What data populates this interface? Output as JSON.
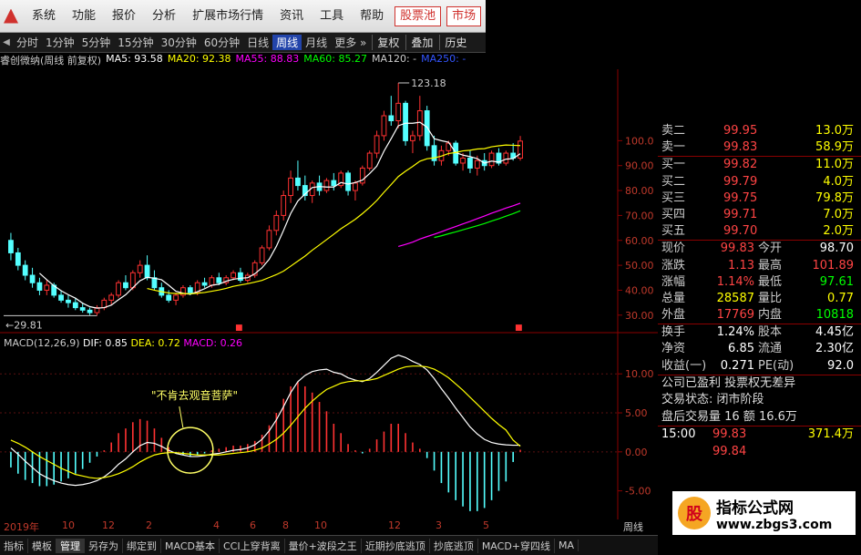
{
  "menu": [
    "系统",
    "功能",
    "报价",
    "分析",
    "扩展市场行情",
    "资讯",
    "工具",
    "帮助"
  ],
  "menu_red": [
    "股票池",
    "市场"
  ],
  "periods": [
    "分时",
    "1分钟",
    "5分钟",
    "15分钟",
    "30分钟",
    "60分钟",
    "日线",
    "周线",
    "月线",
    "更多"
  ],
  "period_active": "周线",
  "period_buttons": [
    "复权",
    "叠加",
    "历史"
  ],
  "stock_title": "睿创微纳(周线 前复权)",
  "ma": [
    {
      "label": "MA5: 93.58",
      "color": "#ffffff"
    },
    {
      "label": "MA20: 92.38",
      "color": "#ffff00"
    },
    {
      "label": "MA55: 88.83",
      "color": "#ff00ff"
    },
    {
      "label": "MA60: 85.27",
      "color": "#00ff00"
    },
    {
      "label": "MA120: -",
      "color": "#cccccc"
    },
    {
      "label": "MA250: -",
      "color": "#3355ff"
    }
  ],
  "price_axis": [
    "100.0",
    "90.00",
    "80.00",
    "70.00",
    "60.00",
    "50.00",
    "40.00",
    "30.00"
  ],
  "macd_axis": [
    "10.00",
    "5.00",
    "0.00",
    "-5.00"
  ],
  "high_label": "123.18",
  "low_label": "29.81",
  "macd_title": "MACD(12,26,9)",
  "macd_dif": "DIF: 0.85",
  "macd_dea": "DEA: 0.72",
  "macd_macd": "MACD: 0.26",
  "annotation": "\"不肯去观音菩萨\"",
  "x_labels": [
    "2019年",
    "10",
    "12",
    "2",
    "4",
    "6",
    "8",
    "10",
    "12",
    "3",
    "5",
    "周线"
  ],
  "quote": {
    "asks": [
      {
        "label": "卖二",
        "price": "99.95",
        "vol": "13.0万"
      },
      {
        "label": "卖一",
        "price": "99.83",
        "vol": "58.9万"
      }
    ],
    "bids": [
      {
        "label": "买一",
        "price": "99.82",
        "vol": "11.0万"
      },
      {
        "label": "买二",
        "price": "99.79",
        "vol": "4.0万"
      },
      {
        "label": "买三",
        "price": "99.75",
        "vol": "79.8万"
      },
      {
        "label": "买四",
        "price": "99.71",
        "vol": "7.0万"
      },
      {
        "label": "买五",
        "price": "99.70",
        "vol": "2.0万"
      }
    ],
    "stats": [
      {
        "l1": "现价",
        "v1": "99.83",
        "c1": "#ff4444",
        "l2": "今开",
        "v2": "98.70",
        "c2": "#ffffff"
      },
      {
        "l1": "涨跌",
        "v1": "1.13",
        "c1": "#ff4444",
        "l2": "最高",
        "v2": "101.89",
        "c2": "#ff4444"
      },
      {
        "l1": "涨幅",
        "v1": "1.14%",
        "c1": "#ff4444",
        "l2": "最低",
        "v2": "97.61",
        "c2": "#00ff00"
      },
      {
        "l1": "总量",
        "v1": "28587",
        "c1": "#ffff00",
        "l2": "量比",
        "v2": "0.77",
        "c2": "#ffff00"
      },
      {
        "l1": "外盘",
        "v1": "17769",
        "c1": "#ff4444",
        "l2": "内盘",
        "v2": "10818",
        "c2": "#00ff00"
      }
    ],
    "stats2": [
      {
        "l1": "换手",
        "v1": "1.24%",
        "l2": "股本",
        "v2": "4.45亿"
      },
      {
        "l1": "净资",
        "v1": "6.85",
        "l2": "流通",
        "v2": "2.30亿"
      },
      {
        "l1": "收益(一)",
        "v1": "0.271",
        "l2": "PE(动)",
        "v2": "92.0"
      }
    ],
    "info": [
      "公司已盈利 投票权无差异",
      "交易状态: 闭市阶段",
      "盘后交易量 16 额 16.6万"
    ],
    "trade": {
      "time": "15:00",
      "price": "99.83",
      "vol": "371.4万"
    },
    "partial_price": "99.84"
  },
  "bottom_tabs": [
    "指标",
    "模板",
    "管理",
    "另存为",
    "绑定到",
    "MACD基本",
    "CCI上穿背离",
    "量价+波段之王",
    "近期抄底逃顶",
    "抄底逃顶",
    "MACD+穿四线",
    "MA"
  ],
  "watermark": {
    "title": "指标公式网",
    "url": "www.zbgs3.com"
  },
  "chart_data": {
    "type": "candlestick",
    "x_labels": [
      "2019年",
      "10",
      "12",
      "2",
      "4",
      "6",
      "8",
      "10",
      "12",
      "3",
      "5"
    ],
    "price_ylim": [
      27,
      125
    ],
    "macd_ylim": [
      -7.5,
      14
    ],
    "candles": [
      [
        60,
        63,
        52,
        55
      ],
      [
        55,
        57,
        48,
        50
      ],
      [
        50,
        52,
        44,
        46
      ],
      [
        46,
        49,
        41,
        43
      ],
      [
        43,
        45,
        38,
        40
      ],
      [
        40,
        44,
        38,
        42
      ],
      [
        42,
        43,
        37,
        38
      ],
      [
        38,
        40,
        35,
        36
      ],
      [
        36,
        38,
        33,
        35
      ],
      [
        35,
        37,
        32,
        33
      ],
      [
        33,
        35,
        31,
        32
      ],
      [
        32,
        33,
        30,
        31
      ],
      [
        31,
        34,
        29.8,
        33
      ],
      [
        33,
        37,
        32,
        36
      ],
      [
        36,
        39,
        34,
        38
      ],
      [
        38,
        44,
        37,
        43
      ],
      [
        43,
        46,
        40,
        41
      ],
      [
        41,
        48,
        40,
        47
      ],
      [
        47,
        52,
        45,
        50
      ],
      [
        50,
        54,
        44,
        45
      ],
      [
        45,
        48,
        40,
        41
      ],
      [
        41,
        43,
        37,
        38
      ],
      [
        38,
        40,
        35,
        36
      ],
      [
        36,
        39,
        34,
        38
      ],
      [
        38,
        42,
        37,
        41
      ],
      [
        41,
        42,
        38,
        39
      ],
      [
        39,
        44,
        38,
        43
      ],
      [
        43,
        45,
        41,
        42
      ],
      [
        42,
        46,
        41,
        45
      ],
      [
        45,
        47,
        42,
        43
      ],
      [
        43,
        46,
        42,
        45
      ],
      [
        45,
        48,
        44,
        47
      ],
      [
        47,
        49,
        43,
        44
      ],
      [
        44,
        47,
        43,
        46
      ],
      [
        46,
        52,
        45,
        51
      ],
      [
        51,
        58,
        50,
        57
      ],
      [
        57,
        66,
        56,
        64
      ],
      [
        64,
        72,
        62,
        70
      ],
      [
        70,
        80,
        68,
        78
      ],
      [
        78,
        88,
        75,
        85
      ],
      [
        85,
        92,
        80,
        82
      ],
      [
        82,
        86,
        76,
        78
      ],
      [
        78,
        84,
        75,
        83
      ],
      [
        83,
        86,
        78,
        80
      ],
      [
        80,
        85,
        79,
        84
      ],
      [
        84,
        87,
        80,
        82
      ],
      [
        82,
        88,
        81,
        87
      ],
      [
        87,
        88,
        78,
        80
      ],
      [
        80,
        84,
        76,
        83
      ],
      [
        83,
        90,
        82,
        89
      ],
      [
        89,
        96,
        88,
        95
      ],
      [
        95,
        104,
        93,
        102
      ],
      [
        102,
        112,
        100,
        110
      ],
      [
        110,
        118,
        106,
        108
      ],
      [
        108,
        123.18,
        105,
        115
      ],
      [
        115,
        116,
        98,
        100
      ],
      [
        100,
        104,
        95,
        102
      ],
      [
        102,
        118,
        100,
        112
      ],
      [
        112,
        114,
        96,
        98
      ],
      [
        98,
        102,
        90,
        92
      ],
      [
        92,
        98,
        90,
        96
      ],
      [
        96,
        100,
        94,
        99
      ],
      [
        99,
        100,
        90,
        91
      ],
      [
        91,
        95,
        88,
        93
      ],
      [
        93,
        96,
        87,
        89
      ],
      [
        89,
        94,
        86,
        92
      ],
      [
        92,
        95,
        88,
        90
      ],
      [
        90,
        96,
        89,
        95
      ],
      [
        95,
        97,
        90,
        91
      ],
      [
        91,
        96,
        90,
        95
      ],
      [
        95,
        99,
        92,
        93
      ],
      [
        93,
        101.89,
        92,
        99.83
      ]
    ],
    "series": [
      {
        "name": "MA5",
        "color": "#ffffff"
      },
      {
        "name": "MA20",
        "color": "#ffff00"
      },
      {
        "name": "MA55",
        "color": "#ff00ff"
      },
      {
        "name": "MA60",
        "color": "#00ff00"
      }
    ],
    "macd": {
      "dif": [
        0.5,
        -0.3,
        -1.2,
        -2.0,
        -2.8,
        -3.3,
        -3.7,
        -4.0,
        -4.2,
        -4.3,
        -4.2,
        -4.0,
        -3.7,
        -3.2,
        -2.5,
        -1.6,
        -0.9,
        0.0,
        0.8,
        1.2,
        1.1,
        0.7,
        0.2,
        -0.2,
        -0.4,
        -0.6,
        -0.6,
        -0.5,
        -0.3,
        -0.2,
        0.0,
        0.2,
        0.3,
        0.5,
        0.9,
        1.6,
        2.7,
        4.1,
        5.8,
        7.6,
        9.0,
        9.8,
        10.3,
        10.5,
        10.6,
        10.2,
        10.0,
        9.5,
        9.2,
        9.0,
        9.4,
        10.2,
        11.1,
        12.0,
        12.4,
        12.1,
        11.6,
        11.2,
        10.5,
        9.4,
        8.1,
        6.9,
        5.6,
        4.4,
        3.2,
        2.3,
        1.6,
        1.2,
        1.0,
        0.9,
        0.85,
        0.85
      ],
      "dea": [
        1.5,
        1.1,
        0.6,
        0.0,
        -0.6,
        -1.1,
        -1.6,
        -2.1,
        -2.5,
        -2.9,
        -3.1,
        -3.3,
        -3.4,
        -3.3,
        -3.1,
        -2.8,
        -2.4,
        -1.9,
        -1.3,
        -0.8,
        -0.4,
        -0.2,
        -0.1,
        -0.1,
        -0.2,
        -0.3,
        -0.4,
        -0.4,
        -0.4,
        -0.4,
        -0.3,
        -0.2,
        -0.1,
        0.0,
        0.2,
        0.5,
        1.0,
        1.6,
        2.4,
        3.4,
        4.5,
        5.6,
        6.5,
        7.3,
        8.0,
        8.4,
        8.8,
        9.0,
        9.1,
        9.1,
        9.2,
        9.4,
        9.8,
        10.2,
        10.6,
        10.9,
        11.0,
        11.0,
        10.9,
        10.6,
        10.1,
        9.5,
        8.7,
        7.9,
        7.0,
        6.1,
        5.2,
        4.3,
        3.5,
        2.8,
        1.5,
        0.72
      ]
    }
  }
}
